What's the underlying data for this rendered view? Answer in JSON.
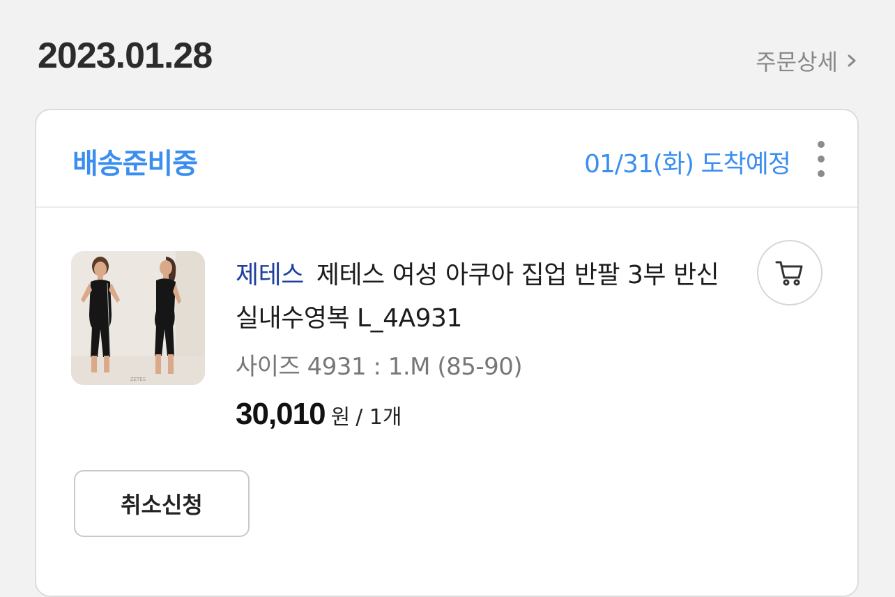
{
  "order": {
    "date": "2023.01.28",
    "detail_link": "주문상세"
  },
  "card": {
    "status": "배송준비중",
    "arrival": "01/31(화) 도착예정",
    "product": {
      "brand": "제테스",
      "title": "제테스 여성 아쿠아 집업 반팔 3부 반신 실내수영복 L_4A931",
      "option": "사이즈 4931 : 1.M (85-90)",
      "price": "30,010",
      "price_unit": "원",
      "quantity": "/ 1개",
      "thumbnail_watermark": "ZETES"
    },
    "cancel_button": "취소신청"
  },
  "colors": {
    "status_blue": "#3b8ef0",
    "brand_navy": "#1f3f9e",
    "background": "#f2f2f2"
  },
  "icons": {
    "detail": "chevron-right-icon",
    "more": "more-vertical-icon",
    "cart": "cart-icon"
  }
}
